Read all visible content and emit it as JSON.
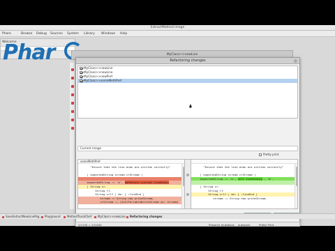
{
  "os": {
    "window_title": "ExtractMethod.image",
    "menu": [
      "Pharo",
      "Browse",
      "Debug",
      "Sources",
      "System",
      "Library",
      "Windows",
      "Help"
    ]
  },
  "background": {
    "small_window_title": "Welcome",
    "logo_text": "Phar",
    "back_window_title": "MyClass>>newLine"
  },
  "dialog": {
    "title": "Refactoring changes",
    "changes": [
      {
        "label": "MyClass>>newLine",
        "checked": true,
        "selected": false
      },
      {
        "label": "MyClass>>newLine",
        "checked": true,
        "selected": false
      },
      {
        "label": "MyClass>>newPref",
        "checked": true,
        "selected": false
      },
      {
        "label": "MyClass>>someMethPref",
        "checked": true,
        "selected": true
      }
    ],
    "breadcrumb": "Current image",
    "pretty_print_label": "Pretty print",
    "left_pane": {
      "header": "someMethPref",
      "lines": [
        {
          "text": "    \"Ensure that the line ends are written correctly\"",
          "style": ""
        },
        {
          "text": "",
          "style": ""
        },
        {
          "text": "  | expectedString stream crStream |",
          "style": ""
        },
        {
          "text": "",
          "style": "del-strong"
        },
        {
          "text": "  expectedString := 'a', ",
          "mark": "AnPattern current lineEndin",
          "style": "del"
        },
        {
          "text": "  | String cr.",
          "style": "hl"
        },
        {
          "text": "       String lf.",
          "style": ""
        },
        {
          "text": "       String crlf | do: [ :lineEnd |",
          "style": ""
        },
        {
          "text": "          stream := String new writeStream.",
          "style": "del"
        },
        {
          "text": "          crStream := (ZnCrPortableWriteStream on: stream)",
          "style": "del"
        }
      ]
    },
    "right_pane": {
      "header": "",
      "lines": [
        {
          "text": "    \"Ensure that the line ends are written correctly\"",
          "style": ""
        },
        {
          "text": "",
          "style": ""
        },
        {
          "text": "  | expectedString stream crStream |",
          "style": ""
        },
        {
          "text": "  expectedString := 'a', ",
          "mark": "self lineEnding",
          "tail": " , 'b'.",
          "style": "add-strong"
        },
        {
          "text": "",
          "style": "add"
        },
        {
          "text": "  | String cr.",
          "style": ""
        },
        {
          "text": "       String lf.",
          "style": ""
        },
        {
          "text": "       String crlf | do: [ :lineEnd |",
          "style": "hl"
        },
        {
          "text": "          stream := String new writeStream.",
          "style": ""
        }
      ]
    },
    "apply_label": "Apply",
    "cancel_label": "Cancel"
  },
  "statusbar": {
    "position": "2/1145 = 1/3,840",
    "options": [
      "Preserve mutations",
      "autosave",
      "Pretty Print"
    ]
  },
  "taskbar": [
    {
      "label": "SaveExtractNewLinePog...",
      "active": false
    },
    {
      "label": "Playground",
      "active": false
    },
    {
      "label": "MethodTrunkChef",
      "active": false
    },
    {
      "label": "MyClass>>newLine",
      "active": false
    },
    {
      "label": "Refactoring changes",
      "active": true
    }
  ],
  "colors": {
    "logo": "#1f6fb3",
    "selection": "#b4d1f0",
    "removed": "#e8806a",
    "added": "#7fe05a"
  }
}
